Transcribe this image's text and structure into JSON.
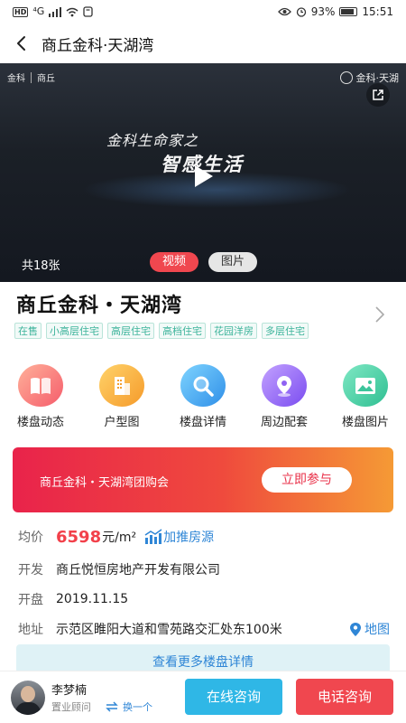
{
  "status_bar": {
    "hd": "HD",
    "signal": "⁴G",
    "battery": "93%",
    "battery_level": 0.93,
    "time": "15:51"
  },
  "nav": {
    "title": "商丘金科·天湖湾"
  },
  "hero": {
    "brand_left": "金科",
    "brand_left_sub": "商丘",
    "brand_right": "金科·天湖",
    "slogan_line1": "金科生命家之",
    "slogan_line2": "智感生活",
    "photo_count": "共18张",
    "tab_video": "视频",
    "tab_image": "图片"
  },
  "project": {
    "name": "商丘金科・天湖湾",
    "tags": [
      "在售",
      "小高层住宅",
      "高层住宅",
      "高档住宅",
      "花园洋房",
      "多层住宅"
    ]
  },
  "quick_links": [
    {
      "label": "楼盘动态",
      "icon": "book-icon",
      "color_from": "#ffb19a",
      "color_to": "#f55c6b"
    },
    {
      "label": "户型图",
      "icon": "building-icon",
      "color_from": "#ffd36a",
      "color_to": "#f59a2a"
    },
    {
      "label": "楼盘详情",
      "icon": "magnifier-icon",
      "color_from": "#7fd4ff",
      "color_to": "#2f8fe8"
    },
    {
      "label": "周边配套",
      "icon": "location-pin-icon",
      "color_from": "#c3a2ff",
      "color_to": "#7a4cf0"
    },
    {
      "label": "楼盘图片",
      "icon": "picture-icon",
      "color_from": "#7fe8c4",
      "color_to": "#2fbf92"
    }
  ],
  "banner": {
    "text": "商丘金科・天湖湾团购会",
    "button": "立即参与"
  },
  "info": {
    "price_label": "均价",
    "price_value": "6598",
    "price_unit": "元/m²",
    "promo_link": "加推房源",
    "developer_label": "开发",
    "developer_value": "商丘悦恒房地产开发有限公司",
    "opening_label": "开盘",
    "opening_value": "2019.11.15",
    "address_label": "地址",
    "address_value": "示范区睢阳大道和雪苑路交汇处东100米",
    "map_link": "地图"
  },
  "more_details": "查看更多楼盘详情",
  "agent": {
    "name": "李梦楠",
    "role": "置业顾问",
    "switch": "换一个"
  },
  "actions": {
    "online": "在线咨询",
    "phone": "电话咨询"
  },
  "colors": {
    "accent_red": "#f0474f",
    "accent_blue": "#2fb7e6",
    "link_blue": "#2f86d6",
    "tag_green": "#3bb39a"
  }
}
